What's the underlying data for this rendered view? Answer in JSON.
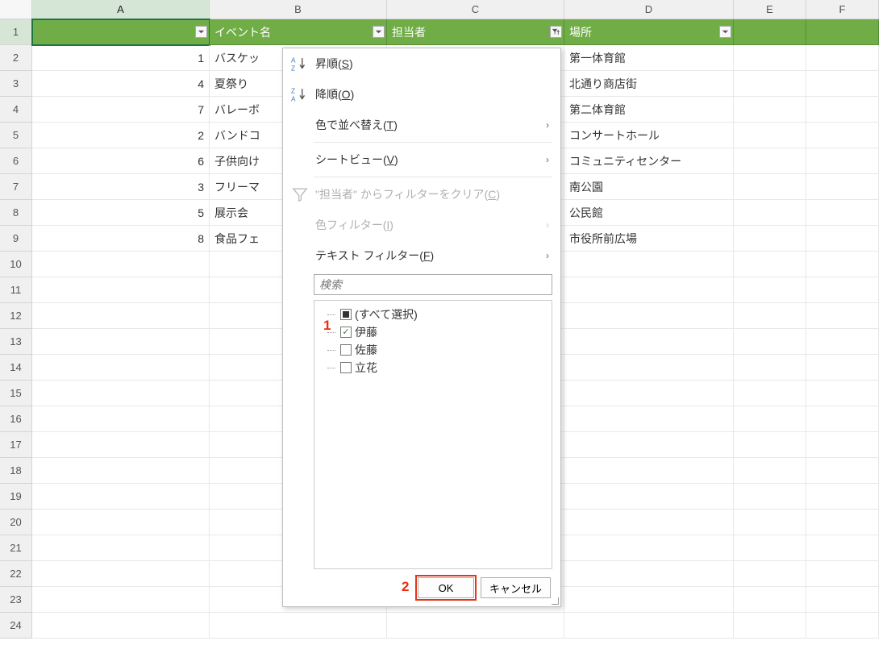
{
  "columns": [
    "A",
    "B",
    "C",
    "D",
    "E",
    "F"
  ],
  "selected_col_index": 0,
  "row_count": 24,
  "header_row": {
    "A": "",
    "B": "イベント名",
    "C": "担当者",
    "D": "場所"
  },
  "active_filter_col": "C",
  "data_rows": [
    {
      "A": "1",
      "B": "バスケッ",
      "D": "第一体育館"
    },
    {
      "A": "4",
      "B": "夏祭り",
      "D": "北通り商店街"
    },
    {
      "A": "7",
      "B": "バレーボ",
      "D": "第二体育館"
    },
    {
      "A": "2",
      "B": "バンドコ",
      "D": "コンサートホール"
    },
    {
      "A": "6",
      "B": "子供向け",
      "D": "コミュニティセンター"
    },
    {
      "A": "3",
      "B": "フリーマ",
      "D": "南公園"
    },
    {
      "A": "5",
      "B": "展示会",
      "D": "公民館"
    },
    {
      "A": "8",
      "B": "食品フェ",
      "D": "市役所前広場"
    }
  ],
  "menu": {
    "asc": {
      "label": "昇順",
      "key": "S"
    },
    "desc": {
      "label": "降順",
      "key": "O"
    },
    "sortByColor": {
      "label": "色で並べ替え",
      "key": "T"
    },
    "sheetView": {
      "label": "シートビュー",
      "key": "V"
    },
    "clearFilter": {
      "prefix": "\"担当者\" からフィルターをクリア",
      "key": "C"
    },
    "colorFilter": {
      "label": "色フィルター",
      "key": "I"
    },
    "textFilter": {
      "label": "テキスト フィルター",
      "key": "F"
    }
  },
  "search": {
    "placeholder": "検索"
  },
  "checklist": {
    "all_label": "(すべて選択)",
    "items": [
      {
        "label": "伊藤",
        "checked": true
      },
      {
        "label": "佐藤",
        "checked": false
      },
      {
        "label": "立花",
        "checked": false
      }
    ]
  },
  "buttons": {
    "ok": "OK",
    "cancel": "キャンセル"
  },
  "annotations": {
    "one": "1",
    "two": "2"
  }
}
